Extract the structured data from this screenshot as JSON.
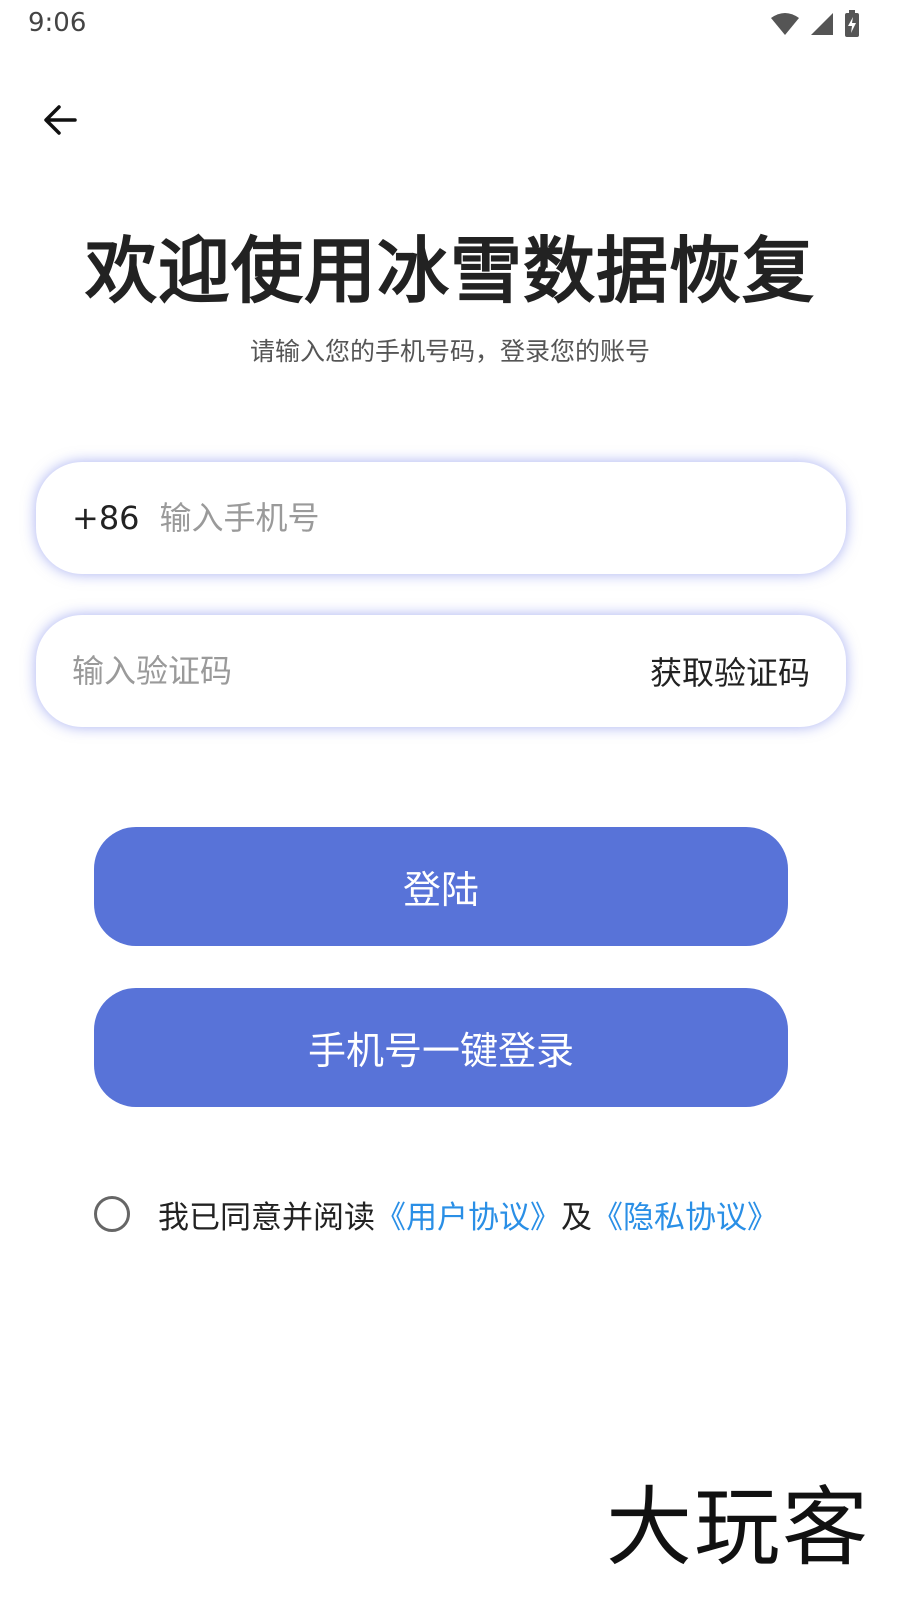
{
  "status_bar": {
    "time": "9:06",
    "icons": [
      "wifi-icon",
      "signal-icon",
      "battery-charging-icon"
    ]
  },
  "header": {
    "back_icon": "arrow-left-icon"
  },
  "welcome": {
    "title": "欢迎使用冰雪数据恢复",
    "subtitle": "请输入您的手机号码，登录您的账号"
  },
  "phone_field": {
    "prefix": "+86",
    "value": "",
    "placeholder": "输入手机号"
  },
  "code_field": {
    "value": "",
    "placeholder": "输入验证码",
    "get_code_label": "获取验证码"
  },
  "buttons": {
    "login_label": "登陆",
    "onekey_label": "手机号一键登录"
  },
  "agreement": {
    "checked": false,
    "prefix": "我已同意并阅读",
    "user_agreement": "《用户协议》",
    "and": "及",
    "privacy_policy": "《隐私协议》"
  },
  "watermark": "大玩客",
  "colors": {
    "primary": "#5873d8",
    "link": "#2a8fe6",
    "field_glow": "#6070e6"
  }
}
